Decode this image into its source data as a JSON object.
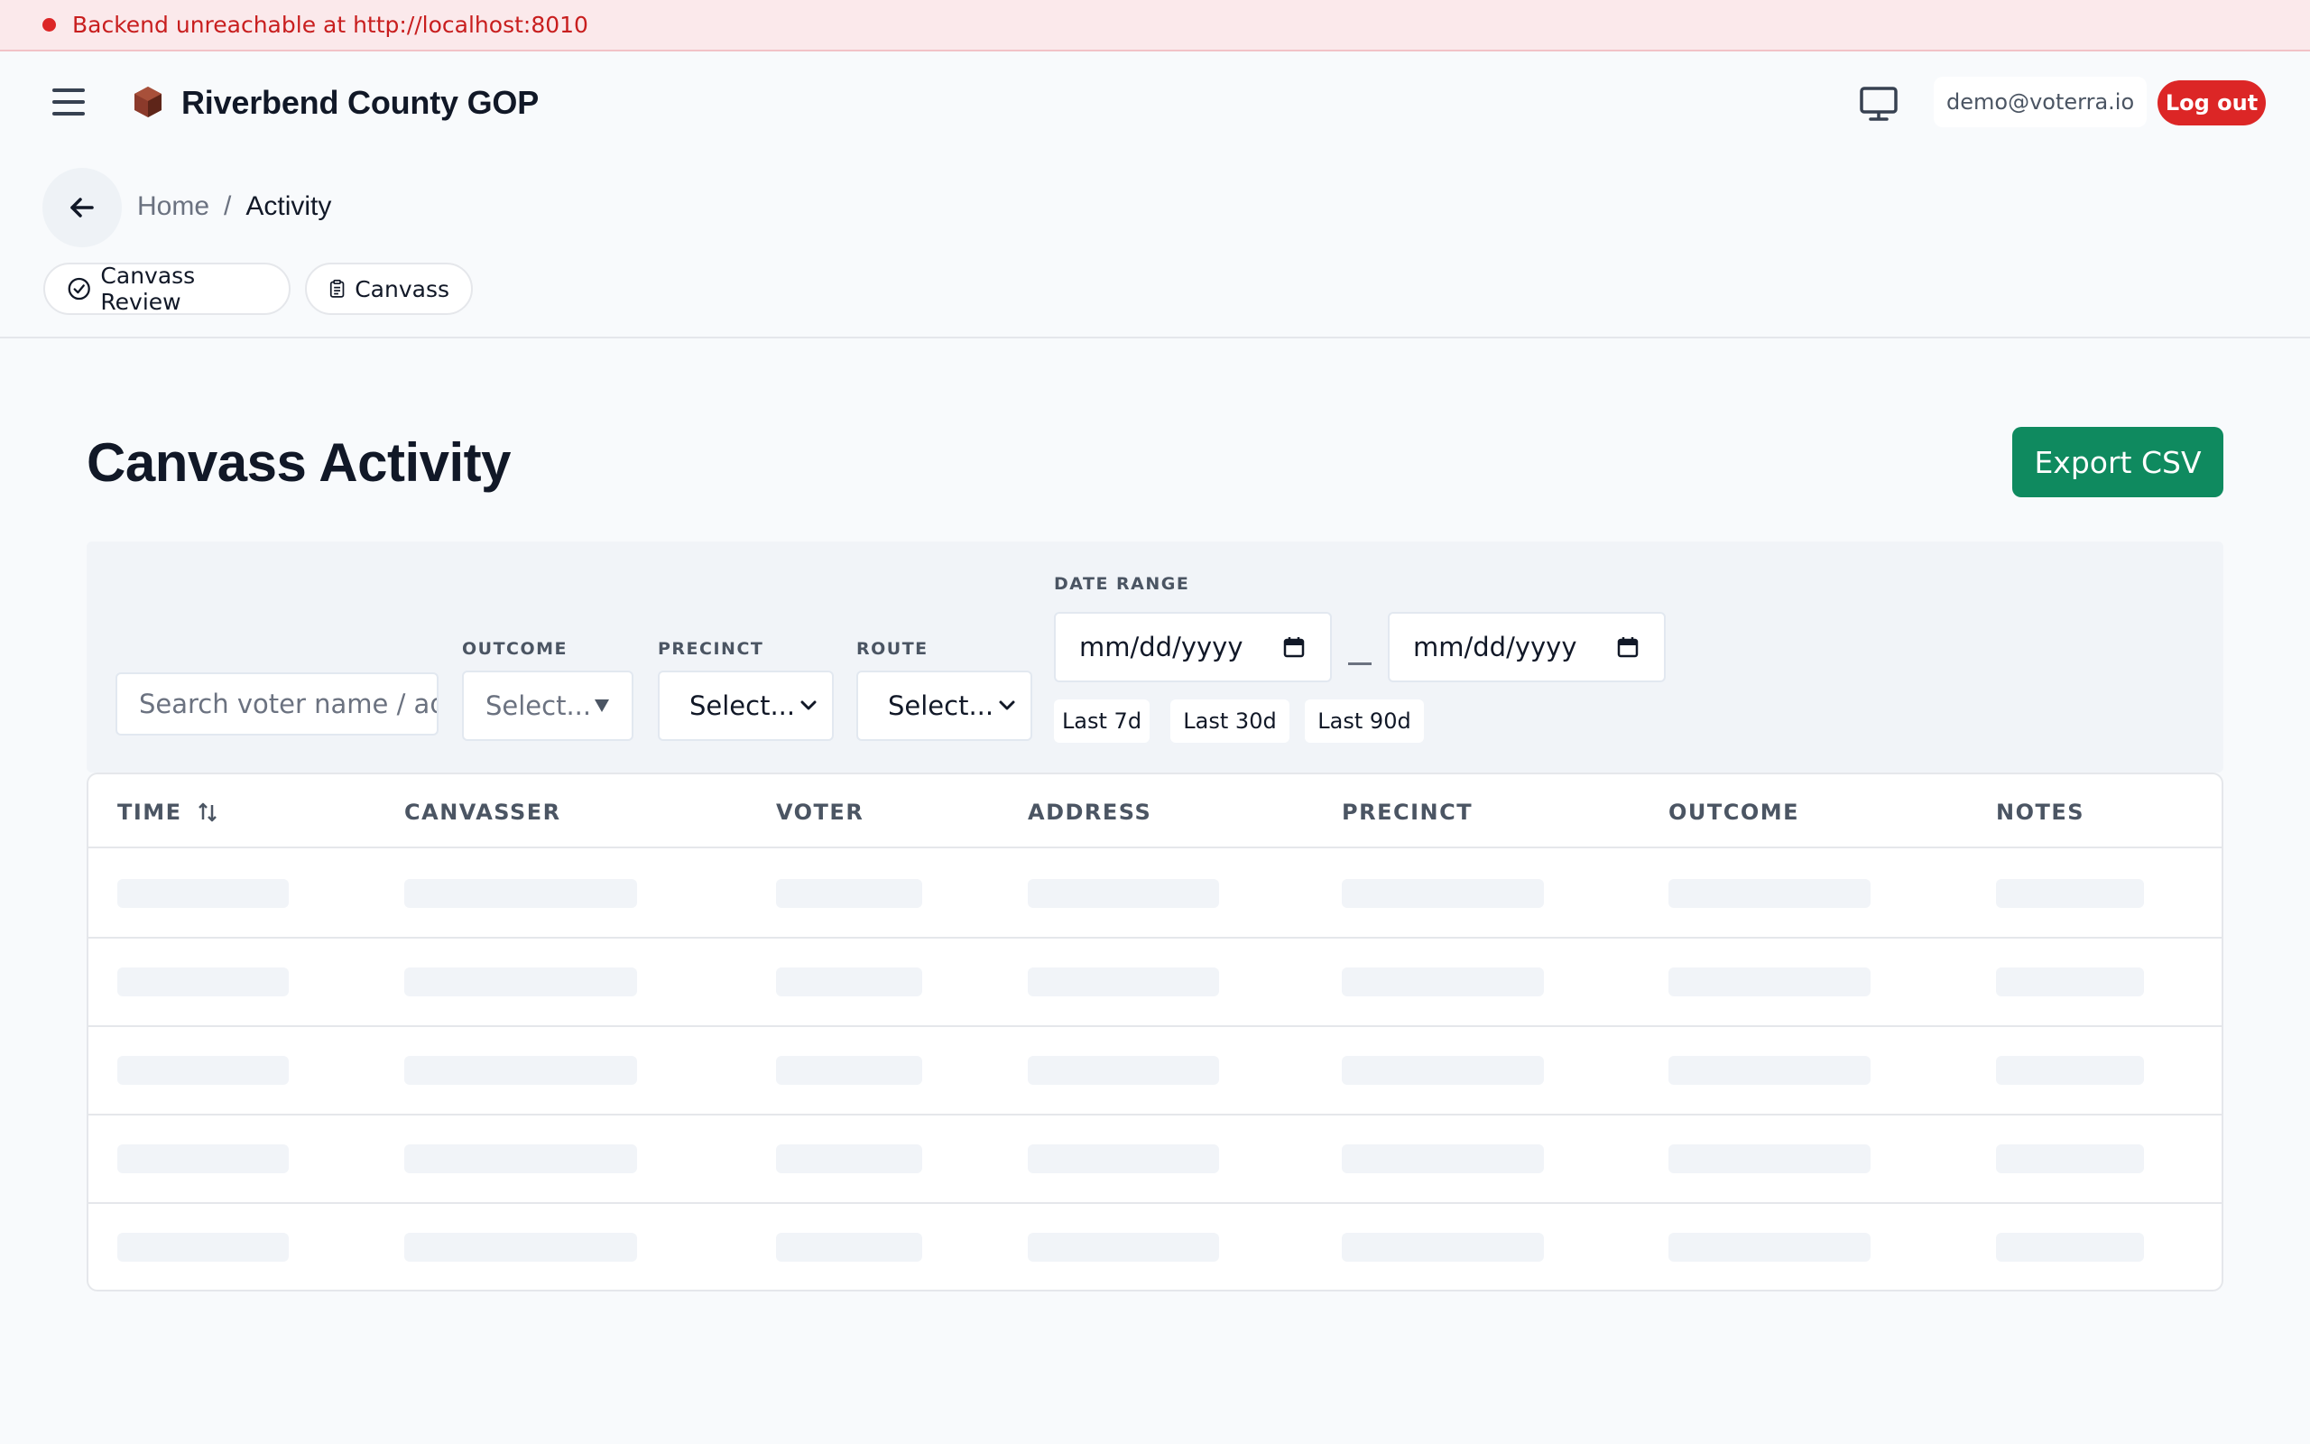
{
  "banner": {
    "message": "Backend unreachable at http://localhost:8010"
  },
  "header": {
    "org_name": "Riverbend County GOP",
    "user_email": "demo@voterra.io",
    "logout_label": "Log out"
  },
  "breadcrumb": {
    "home": "Home",
    "separator": "/",
    "current": "Activity"
  },
  "quick_links": [
    {
      "label": "Canvass Review",
      "icon": "check-circle-icon"
    },
    {
      "label": "Canvass",
      "icon": "clipboard-icon"
    }
  ],
  "page": {
    "title": "Canvass Activity",
    "export_label": "Export CSV"
  },
  "filters": {
    "search_placeholder": "Search voter name / adc",
    "outcome": {
      "label": "OUTCOME",
      "value": "Select..."
    },
    "precinct": {
      "label": "PRECINCT",
      "value": "Select..."
    },
    "route": {
      "label": "ROUTE",
      "value": "Select..."
    },
    "date_range": {
      "label": "DATE RANGE",
      "start_placeholder": "mm/dd/yyyy",
      "end_placeholder": "mm/dd/yyyy",
      "presets": [
        "Last 7d",
        "Last 30d",
        "Last 90d"
      ]
    }
  },
  "table": {
    "columns": [
      "TIME",
      "CANVASSER",
      "VOTER",
      "ADDRESS",
      "PRECINCT",
      "OUTCOME",
      "NOTES"
    ],
    "loading_rows": 5
  },
  "colors": {
    "danger": "#dc2626",
    "export_green": "#0f8a5f",
    "banner_bg": "#fbe9eb",
    "logo": "#8b3a2b"
  }
}
